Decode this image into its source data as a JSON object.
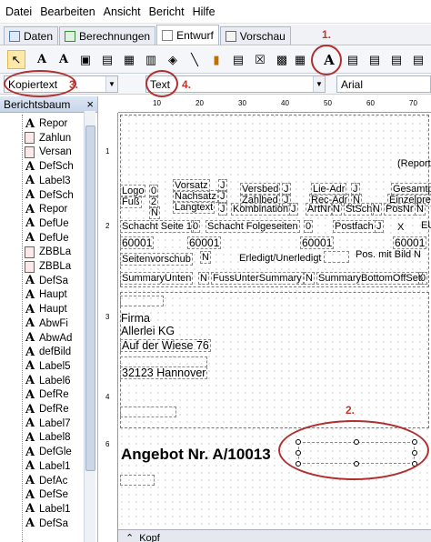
{
  "menu": {
    "items": [
      "Datei",
      "Bearbeiten",
      "Ansicht",
      "Bericht",
      "Hilfe"
    ]
  },
  "tabs": [
    {
      "label": "Daten",
      "active": false
    },
    {
      "label": "Berechnungen",
      "active": false
    },
    {
      "label": "Entwurf",
      "active": true
    },
    {
      "label": "Vorschau",
      "active": false
    }
  ],
  "toolbar": {
    "icons": [
      "pointer-icon",
      "text-icon",
      "text-bold-icon",
      "image-icon",
      "barcode-icon",
      "picture-icon",
      "chart-icon",
      "line-icon",
      "shape-icon",
      "table-icon",
      "checkbox-icon",
      "grid-icon",
      "text-large-icon",
      "text-style-icon",
      "text-style-2-icon",
      "text-style-3-icon",
      "text-style-4-icon"
    ]
  },
  "combos": {
    "style_value": "Kopiertext",
    "type_value": "Text",
    "font_value": "Arial"
  },
  "annotations": {
    "a1": "1.",
    "a2": "2.",
    "a3": "3.",
    "a4": "4."
  },
  "panel": {
    "title": "Berichtsbaum",
    "close": "×"
  },
  "tree": [
    {
      "label": "Repor",
      "type": "text"
    },
    {
      "label": "Zahlun",
      "type": "image"
    },
    {
      "label": "Versan",
      "type": "image"
    },
    {
      "label": "DefSch",
      "type": "text"
    },
    {
      "label": "Label3",
      "type": "text"
    },
    {
      "label": "DefSch",
      "type": "text"
    },
    {
      "label": "Repor",
      "type": "text"
    },
    {
      "label": "DefUe",
      "type": "text"
    },
    {
      "label": "DefUe",
      "type": "text"
    },
    {
      "label": "ZBBLa",
      "type": "image"
    },
    {
      "label": "ZBBLa",
      "type": "image"
    },
    {
      "label": "DefSa",
      "type": "text"
    },
    {
      "label": "Haupt",
      "type": "text"
    },
    {
      "label": "Haupt",
      "type": "text"
    },
    {
      "label": "AbwFi",
      "type": "text"
    },
    {
      "label": "AbwAd",
      "type": "text"
    },
    {
      "label": "defBild",
      "type": "text"
    },
    {
      "label": "Label5",
      "type": "text"
    },
    {
      "label": "Label6",
      "type": "text"
    },
    {
      "label": "DefRe",
      "type": "text"
    },
    {
      "label": "DefRe",
      "type": "text"
    },
    {
      "label": "Label7",
      "type": "text"
    },
    {
      "label": "Label8",
      "type": "text"
    },
    {
      "label": "DefGle",
      "type": "text"
    },
    {
      "label": "Label1",
      "type": "text"
    },
    {
      "label": "DefAc",
      "type": "text"
    },
    {
      "label": "DefSe",
      "type": "text"
    },
    {
      "label": "Label1",
      "type": "text"
    },
    {
      "label": "DefSa",
      "type": "text"
    }
  ],
  "ruler": {
    "marks": [
      "10",
      "20",
      "30",
      "40",
      "50",
      "60",
      "70"
    ]
  },
  "report": {
    "reportname": "(Report",
    "r1": [
      "Logo",
      "0",
      "Vorsatz",
      "J",
      "Versbed",
      "J",
      "Lie-Adr",
      "J",
      "Gesamtp"
    ],
    "r2": [
      "Fuß",
      "2",
      "Nachsatz",
      "J",
      "Zahlbed",
      "J",
      "Rec-Adr",
      "N",
      "Einzelpre"
    ],
    "r3": [
      "N",
      "Langtext",
      "J",
      "Kombination",
      "J",
      "ArtNr",
      "N",
      "StSch",
      "N",
      "PosNr",
      "N"
    ],
    "r4": [
      "Schacht Seite 1",
      "0",
      "Schacht Folgeseiten",
      "0",
      "Postfach",
      "J",
      "X",
      "EU"
    ],
    "r5": [
      "60001",
      "60001",
      "60001",
      "60001"
    ],
    "r6": [
      "Seitenvorschub",
      "N",
      "Erledigt/Unerledigt",
      "Pos. mit Bild",
      "N"
    ],
    "r7": [
      "SummaryUnten",
      "N",
      "FussUnterSummary",
      "N",
      "SummaryBottomOffSet",
      "0",
      "WW"
    ],
    "addr": [
      "Firma",
      "Allerlei KG",
      "Auf der Wiese 76",
      "",
      "32123 Hannover"
    ],
    "angebot": "Angebot Nr. A/10013",
    "kopf": "Kopf"
  }
}
